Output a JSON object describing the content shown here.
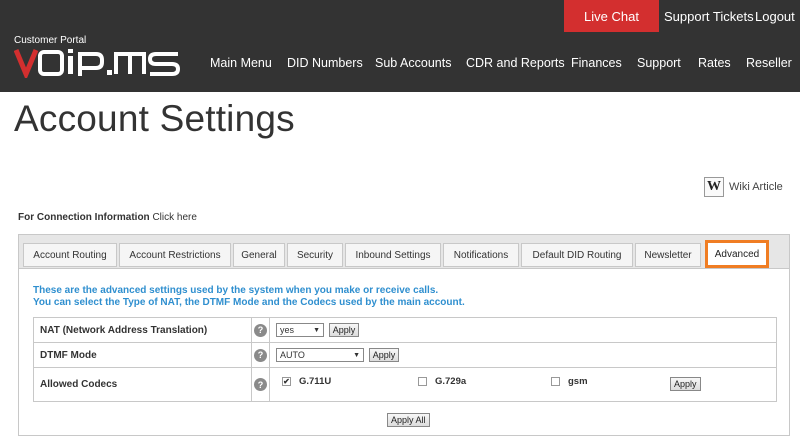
{
  "header": {
    "live_chat": "Live Chat",
    "support_tickets": "Support Tickets",
    "logout": "Logout",
    "portal_label": "Customer Portal",
    "logo_text": "VOiP.MS",
    "nav": [
      "Main Menu",
      "DID Numbers",
      "Sub Accounts",
      "CDR and Reports",
      "Finances",
      "Support",
      "Rates",
      "Reseller"
    ],
    "colors": {
      "bar": "#333333",
      "live_chat": "#d32f2f",
      "logo_red": "#d32f2f"
    }
  },
  "page": {
    "title": "Account Settings",
    "wiki_icon": "W",
    "wiki_label": "Wiki Article",
    "conn_info_bold": "For Connection Information",
    "conn_info_link": "Click here"
  },
  "tabs": [
    "Account Routing",
    "Account Restrictions",
    "General",
    "Security",
    "Inbound Settings",
    "Notifications",
    "Default DID Routing",
    "Newsletter",
    "Advanced"
  ],
  "active_tab": "Advanced",
  "advanced": {
    "desc_line1": "These are the advanced settings used by the system when you make or receive calls.",
    "desc_line2": "You can select the Type of NAT, the DTMF Mode and the Codecs used by the main account.",
    "nat_label": "NAT (Network Address Translation)",
    "nat_value": "yes",
    "dtmf_label": "DTMF Mode",
    "dtmf_value": "AUTO",
    "codecs_label": "Allowed Codecs",
    "codecs": [
      {
        "name": "G.711U",
        "checked": true
      },
      {
        "name": "G.729a",
        "checked": false
      },
      {
        "name": "gsm",
        "checked": false
      }
    ],
    "apply": "Apply",
    "apply_all": "Apply All",
    "help": "?"
  }
}
